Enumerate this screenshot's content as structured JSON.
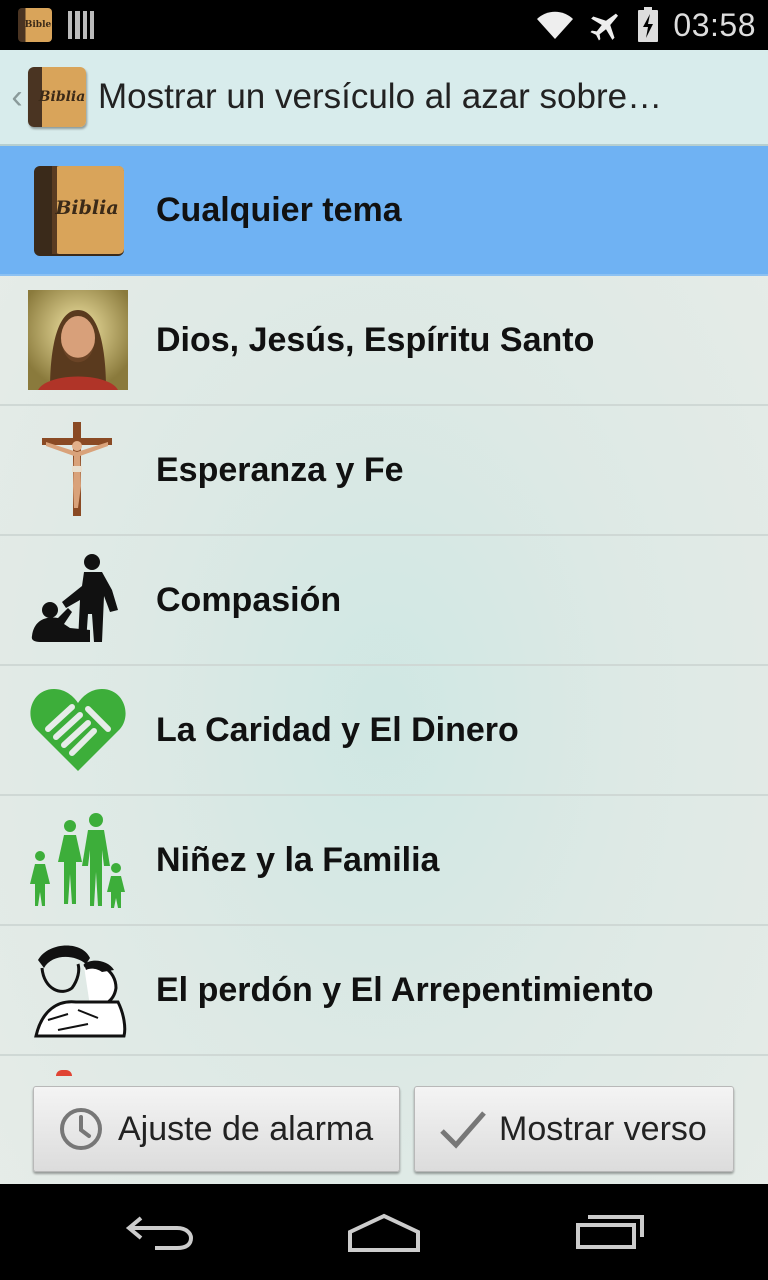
{
  "status_bar": {
    "notification_icons": [
      "bible-app-notification-icon",
      "barcode-notification-icon"
    ],
    "notification_book_text": "Bible",
    "system_icons": [
      "wifi-icon",
      "airplane-mode-icon",
      "battery-charging-icon"
    ],
    "time": "03:58"
  },
  "action_bar": {
    "icon_text": "Biblia",
    "title": "Mostrar un versículo al azar sobre…"
  },
  "topics": [
    {
      "label": "Cualquier tema",
      "icon": "bible-book-icon",
      "selected": true
    },
    {
      "label": "Dios, Jesús, Espíritu Santo",
      "icon": "jesus-portrait-icon",
      "selected": false
    },
    {
      "label": "Esperanza y Fe",
      "icon": "crucifix-icon",
      "selected": false
    },
    {
      "label": "Compasión",
      "icon": "helping-hand-icon",
      "selected": false
    },
    {
      "label": "La Caridad y El Dinero",
      "icon": "heart-handshake-icon",
      "selected": false
    },
    {
      "label": "Niñez y la Familia",
      "icon": "family-icon",
      "selected": false
    },
    {
      "label": "El perdón y El Arrepentimiento",
      "icon": "forgiveness-embrace-icon",
      "selected": false
    }
  ],
  "buttons": {
    "alarm": {
      "label": "Ajuste de alarma",
      "icon": "clock-icon"
    },
    "show": {
      "label": "Mostrar verso",
      "icon": "checkmark-icon"
    }
  },
  "nav_bar": [
    "back-nav-icon",
    "home-nav-icon",
    "recent-apps-nav-icon"
  ],
  "colors": {
    "selected_row": "#6fb2f3",
    "action_bar": "#d8ecec",
    "green_icons": "#3dae3a"
  }
}
